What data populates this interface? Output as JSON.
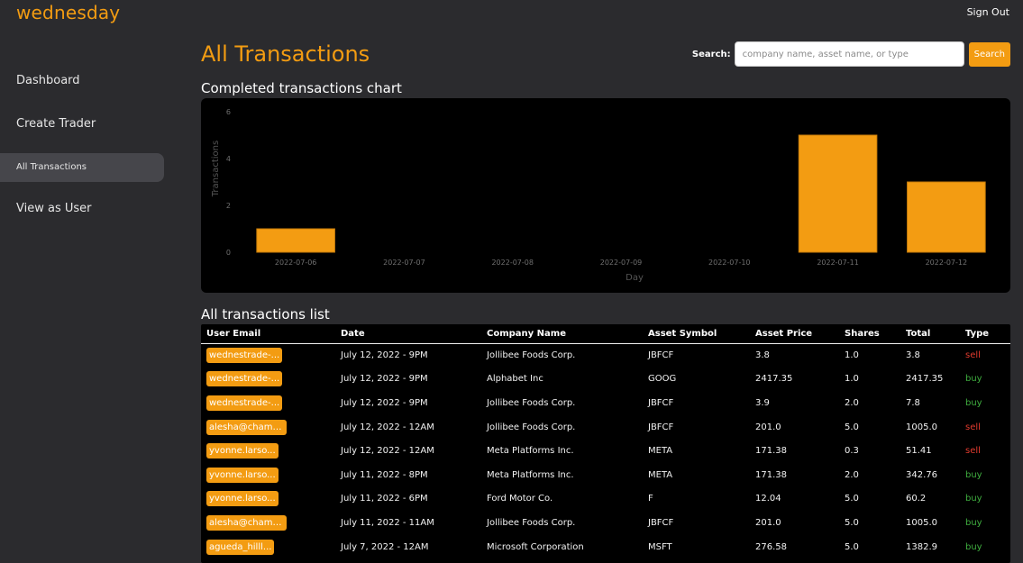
{
  "app": {
    "brand": "wednesday",
    "sign_out": "Sign Out"
  },
  "sidebar": {
    "items": [
      {
        "label": "Dashboard"
      },
      {
        "label": "Create Trader"
      },
      {
        "label": "All Transactions"
      },
      {
        "label": "View as User"
      }
    ]
  },
  "page": {
    "title": "All Transactions"
  },
  "search": {
    "label": "Search:",
    "placeholder": "company name, asset name, or type",
    "value": "",
    "button": "Search"
  },
  "chart_section": {
    "title": "Completed transactions chart"
  },
  "chart_data": {
    "type": "bar",
    "title": "",
    "xlabel": "Day",
    "ylabel": "Transactions",
    "categories": [
      "2022-07-06",
      "2022-07-07",
      "2022-07-08",
      "2022-07-09",
      "2022-07-10",
      "2022-07-11",
      "2022-07-12"
    ],
    "values": [
      1,
      0,
      0,
      0,
      0,
      5,
      3
    ],
    "ylim": [
      0,
      6
    ],
    "yticks": [
      0,
      2,
      4,
      6
    ],
    "bar_color": "#f39c12",
    "grid": false,
    "legend": "none"
  },
  "list_section": {
    "title": "All transactions list"
  },
  "table": {
    "columns": [
      "User Email",
      "Date",
      "Company Name",
      "Asset Symbol",
      "Asset Price",
      "Shares",
      "Total",
      "Type"
    ],
    "rows": [
      {
        "email": "wednestrade-...",
        "date": "July 12, 2022 - 9PM",
        "company": "Jollibee Foods Corp.",
        "symbol": "JBFCF",
        "price": "3.8",
        "shares": "1.0",
        "total": "3.8",
        "type": "sell"
      },
      {
        "email": "wednestrade-...",
        "date": "July 12, 2022 - 9PM",
        "company": "Alphabet Inc",
        "symbol": "GOOG",
        "price": "2417.35",
        "shares": "1.0",
        "total": "2417.35",
        "type": "buy"
      },
      {
        "email": "wednestrade-...",
        "date": "July 12, 2022 - 9PM",
        "company": "Jollibee Foods Corp.",
        "symbol": "JBFCF",
        "price": "3.9",
        "shares": "2.0",
        "total": "7.8",
        "type": "buy"
      },
      {
        "email": "alesha@champ...",
        "date": "July 12, 2022 - 12AM",
        "company": "Jollibee Foods Corp.",
        "symbol": "JBFCF",
        "price": "201.0",
        "shares": "5.0",
        "total": "1005.0",
        "type": "sell"
      },
      {
        "email": "yvonne.larso...",
        "date": "July 12, 2022 - 12AM",
        "company": "Meta Platforms Inc.",
        "symbol": "META",
        "price": "171.38",
        "shares": "0.3",
        "total": "51.41",
        "type": "sell"
      },
      {
        "email": "yvonne.larso...",
        "date": "July 11, 2022 - 8PM",
        "company": "Meta Platforms Inc.",
        "symbol": "META",
        "price": "171.38",
        "shares": "2.0",
        "total": "342.76",
        "type": "buy"
      },
      {
        "email": "yvonne.larso...",
        "date": "July 11, 2022 - 6PM",
        "company": "Ford Motor Co.",
        "symbol": "F",
        "price": "12.04",
        "shares": "5.0",
        "total": "60.2",
        "type": "buy"
      },
      {
        "email": "alesha@champ...",
        "date": "July 11, 2022 - 11AM",
        "company": "Jollibee Foods Corp.",
        "symbol": "JBFCF",
        "price": "201.0",
        "shares": "5.0",
        "total": "1005.0",
        "type": "buy"
      },
      {
        "email": "agueda_hilll...",
        "date": "July 7, 2022 - 12AM",
        "company": "Microsoft Corporation",
        "symbol": "MSFT",
        "price": "276.58",
        "shares": "5.0",
        "total": "1382.9",
        "type": "buy"
      }
    ]
  },
  "colors": {
    "accent": "#f39c12",
    "sell": "#e23b2e",
    "buy": "#3fae3f",
    "background": "#2b2b2e"
  }
}
